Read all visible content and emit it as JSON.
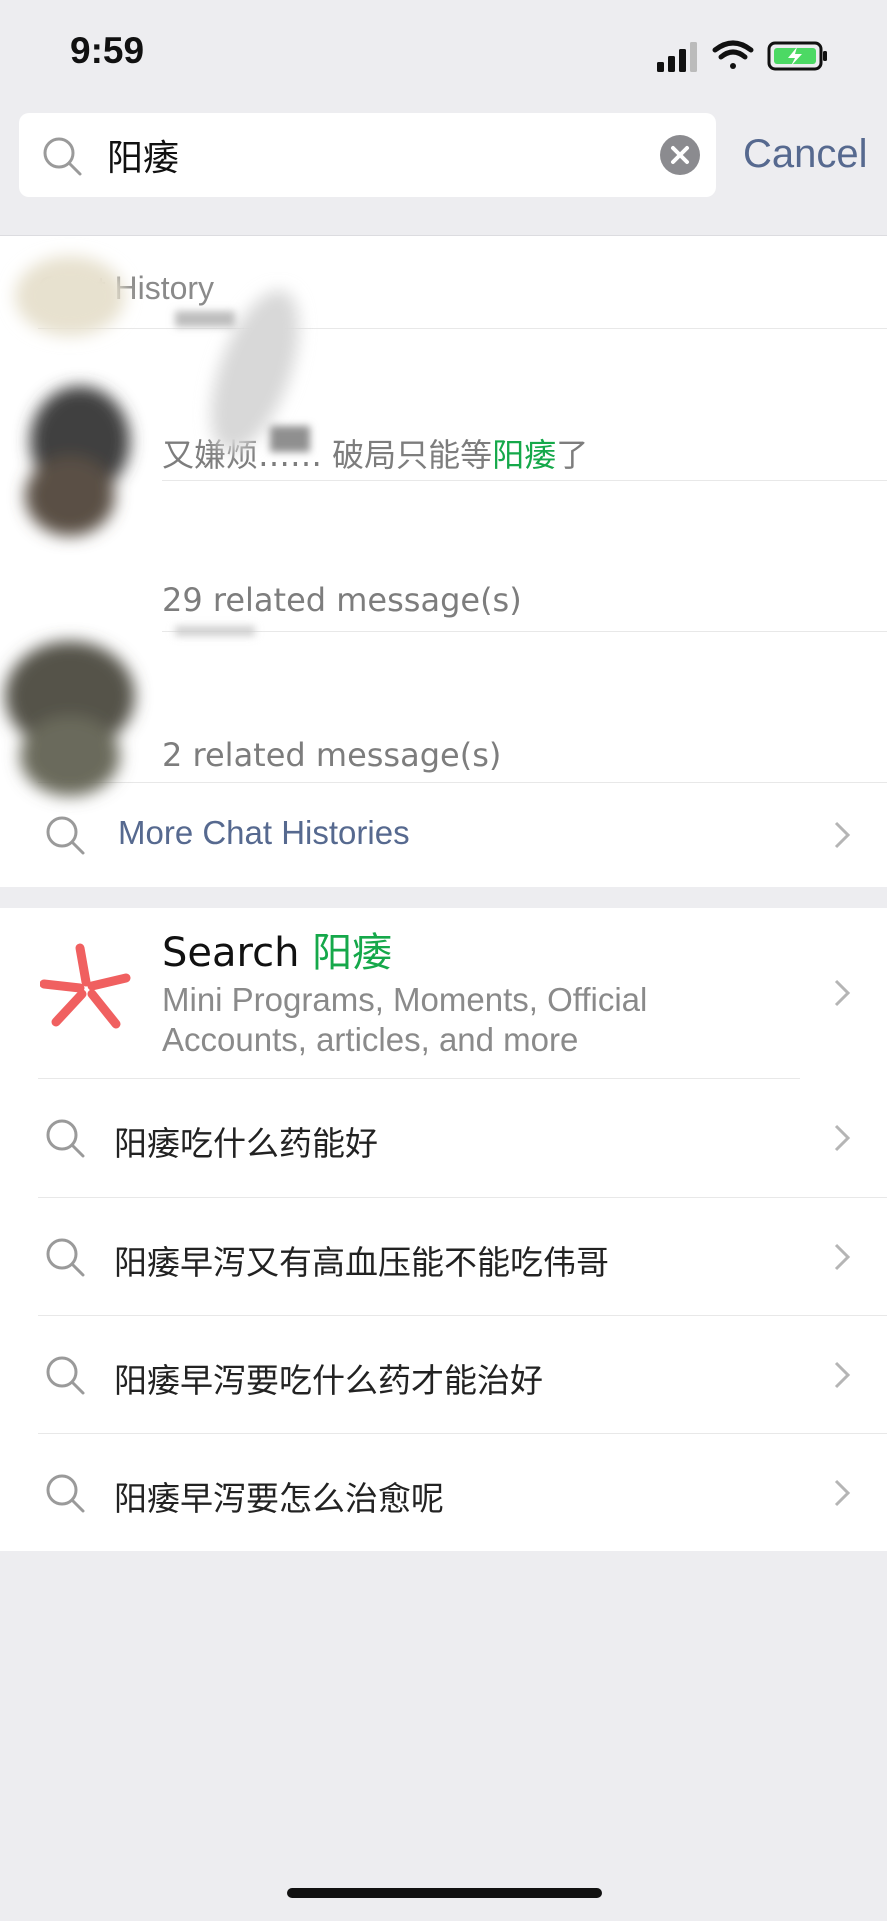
{
  "status": {
    "time": "9:59"
  },
  "search": {
    "query": "阳痿",
    "cancel_label": "Cancel"
  },
  "chat_history": {
    "title": "Chat History",
    "results": [
      {
        "snippet_pre": "又嫌烦…… 破局只能等",
        "snippet_hl": "阳痿",
        "snippet_post": "了"
      },
      {
        "snippet": "29 related message(s)"
      },
      {
        "snippet": "2 related message(s)"
      }
    ],
    "more_label": "More Chat Histories"
  },
  "web_search": {
    "title_prefix": "Search",
    "title_highlight": "阳痿",
    "description": "Mini Programs, Moments, Official Accounts, articles, and more"
  },
  "suggestions": [
    "阳痿吃什么药能好",
    "阳痿早泻又有高血压能不能吃伟哥",
    "阳痿早泻要吃什么药才能治好",
    "阳痿早泻要怎么治愈呢"
  ],
  "colors": {
    "highlight": "#15a84a",
    "link": "#56698f",
    "background": "#ededf0"
  }
}
